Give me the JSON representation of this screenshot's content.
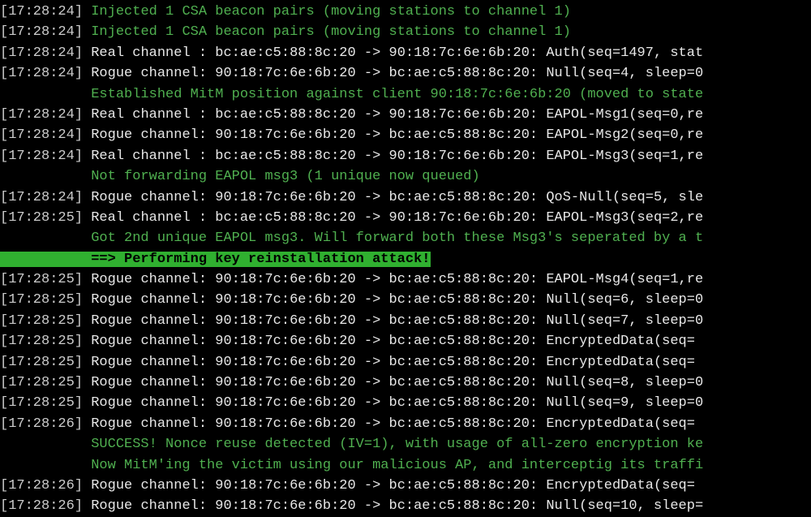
{
  "lines": [
    {
      "ts": "[17:28:24]",
      "style": "green",
      "text": " Injected 1 CSA beacon pairs (moving stations to channel 1)"
    },
    {
      "ts": "[17:28:24]",
      "style": "green",
      "text": " Injected 1 CSA beacon pairs (moving stations to channel 1)"
    },
    {
      "ts": "[17:28:24]",
      "style": "white",
      "text": " Real channel : bc:ae:c5:88:8c:20 -> 90:18:7c:6e:6b:20: Auth(seq=1497, stat"
    },
    {
      "ts": "[17:28:24]",
      "style": "white",
      "text": " Rogue channel: 90:18:7c:6e:6b:20 -> bc:ae:c5:88:8c:20: Null(seq=4, sleep=0"
    },
    {
      "ts": "",
      "style": "green",
      "text": "           Established MitM position against client 90:18:7c:6e:6b:20 (moved to state"
    },
    {
      "ts": "[17:28:24]",
      "style": "white",
      "text": " Real channel : bc:ae:c5:88:8c:20 -> 90:18:7c:6e:6b:20: EAPOL-Msg1(seq=0,re"
    },
    {
      "ts": "[17:28:24]",
      "style": "white",
      "text": " Rogue channel: 90:18:7c:6e:6b:20 -> bc:ae:c5:88:8c:20: EAPOL-Msg2(seq=0,re"
    },
    {
      "ts": "[17:28:24]",
      "style": "white",
      "text": " Real channel : bc:ae:c5:88:8c:20 -> 90:18:7c:6e:6b:20: EAPOL-Msg3(seq=1,re"
    },
    {
      "ts": "",
      "style": "green",
      "text": "           Not forwarding EAPOL msg3 (1 unique now queued)"
    },
    {
      "ts": "[17:28:24]",
      "style": "white",
      "text": " Rogue channel: 90:18:7c:6e:6b:20 -> bc:ae:c5:88:8c:20: QoS-Null(seq=5, sle"
    },
    {
      "ts": "[17:28:25]",
      "style": "white",
      "text": " Real channel : bc:ae:c5:88:8c:20 -> 90:18:7c:6e:6b:20: EAPOL-Msg3(seq=2,re"
    },
    {
      "ts": "",
      "style": "green",
      "text": "           Got 2nd unique EAPOL msg3. Will forward both these Msg3's seperated by a t"
    },
    {
      "ts": "",
      "style": "highlight",
      "text": "           ==> Performing key reinstallation attack!"
    },
    {
      "ts": "[17:28:25]",
      "style": "white",
      "text": " Rogue channel: 90:18:7c:6e:6b:20 -> bc:ae:c5:88:8c:20: EAPOL-Msg4(seq=1,re"
    },
    {
      "ts": "[17:28:25]",
      "style": "white",
      "text": " Rogue channel: 90:18:7c:6e:6b:20 -> bc:ae:c5:88:8c:20: Null(seq=6, sleep=0"
    },
    {
      "ts": "[17:28:25]",
      "style": "white",
      "text": " Rogue channel: 90:18:7c:6e:6b:20 -> bc:ae:c5:88:8c:20: Null(seq=7, sleep=0"
    },
    {
      "ts": "[17:28:25]",
      "style": "white",
      "text": " Rogue channel: 90:18:7c:6e:6b:20 -> bc:ae:c5:88:8c:20: EncryptedData(seq="
    },
    {
      "ts": "[17:28:25]",
      "style": "white",
      "text": " Rogue channel: 90:18:7c:6e:6b:20 -> bc:ae:c5:88:8c:20: EncryptedData(seq="
    },
    {
      "ts": "[17:28:25]",
      "style": "white",
      "text": " Rogue channel: 90:18:7c:6e:6b:20 -> bc:ae:c5:88:8c:20: Null(seq=8, sleep=0"
    },
    {
      "ts": "[17:28:25]",
      "style": "white",
      "text": " Rogue channel: 90:18:7c:6e:6b:20 -> bc:ae:c5:88:8c:20: Null(seq=9, sleep=0"
    },
    {
      "ts": "[17:28:26]",
      "style": "white",
      "text": " Rogue channel: 90:18:7c:6e:6b:20 -> bc:ae:c5:88:8c:20: EncryptedData(seq="
    },
    {
      "ts": "",
      "style": "green",
      "text": "           SUCCESS! Nonce reuse detected (IV=1), with usage of all-zero encryption ke"
    },
    {
      "ts": "",
      "style": "green",
      "text": "           Now MitM'ing the victim using our malicious AP, and interceptig its traffi"
    },
    {
      "ts": "[17:28:26]",
      "style": "white",
      "text": " Rogue channel: 90:18:7c:6e:6b:20 -> bc:ae:c5:88:8c:20: EncryptedData(seq="
    },
    {
      "ts": "[17:28:26]",
      "style": "white",
      "text": " Rogue channel: 90:18:7c:6e:6b:20 -> bc:ae:c5:88:8c:20: Null(seq=10, sleep="
    }
  ]
}
